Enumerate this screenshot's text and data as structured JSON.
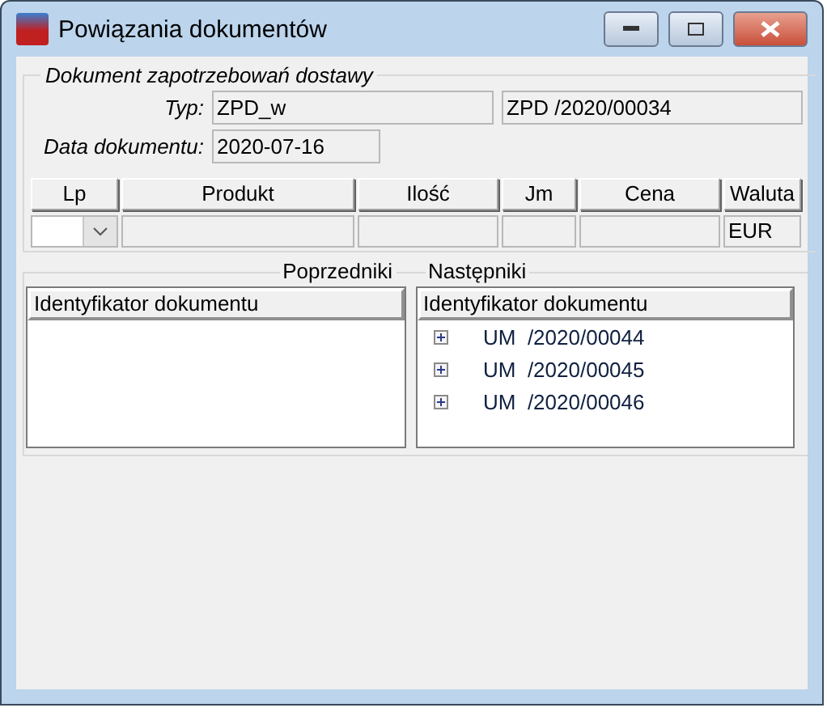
{
  "window": {
    "title": "Powiązania dokumentów"
  },
  "document": {
    "group_title": "Dokument zapotrzebowań dostawy",
    "type_label": "Typ:",
    "type_value": "ZPD_w",
    "number_value": "ZPD /2020/00034",
    "date_label": "Data dokumentu:",
    "date_value": "2020-07-16"
  },
  "grid": {
    "columns": [
      "Lp",
      "Produkt",
      "Ilość",
      "Jm",
      "Cena",
      "Waluta"
    ],
    "row": {
      "currency": "EUR"
    }
  },
  "predecessors": {
    "title": "Poprzedniki",
    "column": "Identyfikator dokumentu"
  },
  "successors": {
    "title": "Następniki",
    "column": "Identyfikator dokumentu",
    "items": [
      {
        "label": "UM  /2020/00044",
        "expanded": false
      },
      {
        "label": "UM  /2020/00045",
        "expanded": false
      },
      {
        "label": "UM  /2020/00046",
        "expanded": false
      }
    ]
  }
}
